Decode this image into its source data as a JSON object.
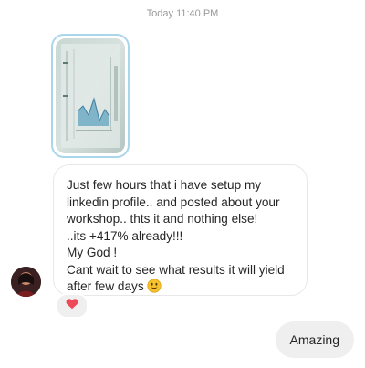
{
  "chat": {
    "timestamp": "Today 11:40 PM",
    "received": {
      "lines": [
        "Just few hours that i have setup my",
        "linkedin profile.. and posted about your",
        "workshop.. thts it and nothing else!",
        " ..its +417% already!!!",
        "My God !",
        "Cant wait to see what results it will yield",
        "after few days"
      ],
      "emoji": "smiley-face",
      "reaction": "heart"
    },
    "sent": {
      "text": "Amazing"
    }
  },
  "colors": {
    "image_border": "#a9d6ea",
    "reaction_heart": "#ed4956",
    "bubble_border": "#e8e8e8",
    "sent_bubble_bg": "#efefef",
    "text": "#262626",
    "timestamp": "#9a9a9a"
  }
}
